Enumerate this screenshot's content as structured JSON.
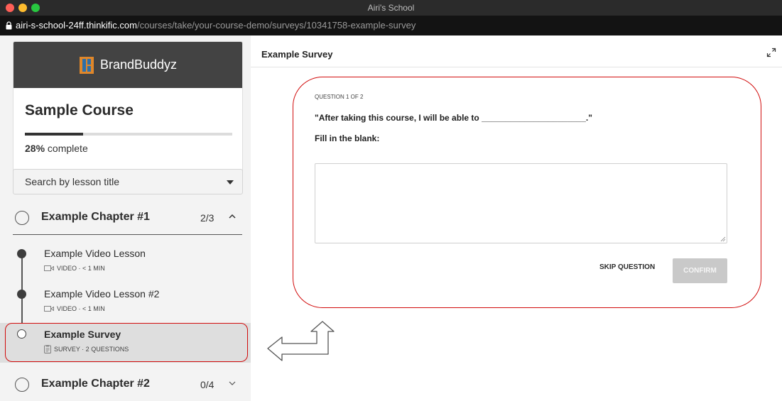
{
  "window": {
    "title": "Airi's School",
    "url_host": "airi-s-school-24ff.thinkific.com",
    "url_path": "/courses/take/your-course-demo/surveys/10341758-example-survey"
  },
  "sidebar": {
    "brand_name": "BrandBuddyz",
    "course_title": "Sample Course",
    "progress_percent": 28,
    "progress_value": "28%",
    "progress_suffix": "complete",
    "search_label": "Search by lesson title",
    "chapters": [
      {
        "title": "Example Chapter #1",
        "count": "2/3",
        "expanded": true,
        "lessons": [
          {
            "title": "Example Video Lesson",
            "meta": "VIDEO · < 1 MIN",
            "status": "complete",
            "icon": "video-icon"
          },
          {
            "title": "Example Video Lesson #2",
            "meta": "VIDEO · < 1 MIN",
            "status": "complete",
            "icon": "video-icon"
          },
          {
            "title": "Example Survey",
            "meta": "SURVEY · 2 QUESTIONS",
            "status": "current",
            "icon": "survey-icon"
          }
        ]
      },
      {
        "title": "Example Chapter #2",
        "count": "0/4",
        "expanded": false
      }
    ]
  },
  "main": {
    "title": "Example Survey",
    "question_counter": "QUESTION 1 OF 2",
    "question_prompt": "\"After taking this course, I will be able to ______________________.\"",
    "question_instruction": "Fill in the blank:",
    "answer_value": "",
    "skip_label": "SKIP QUESTION",
    "confirm_label": "CONFIRM"
  },
  "colors": {
    "annotation_red": "#d10b0b",
    "brand_bar": "#434343",
    "confirm_disabled": "#c9c9c9"
  }
}
